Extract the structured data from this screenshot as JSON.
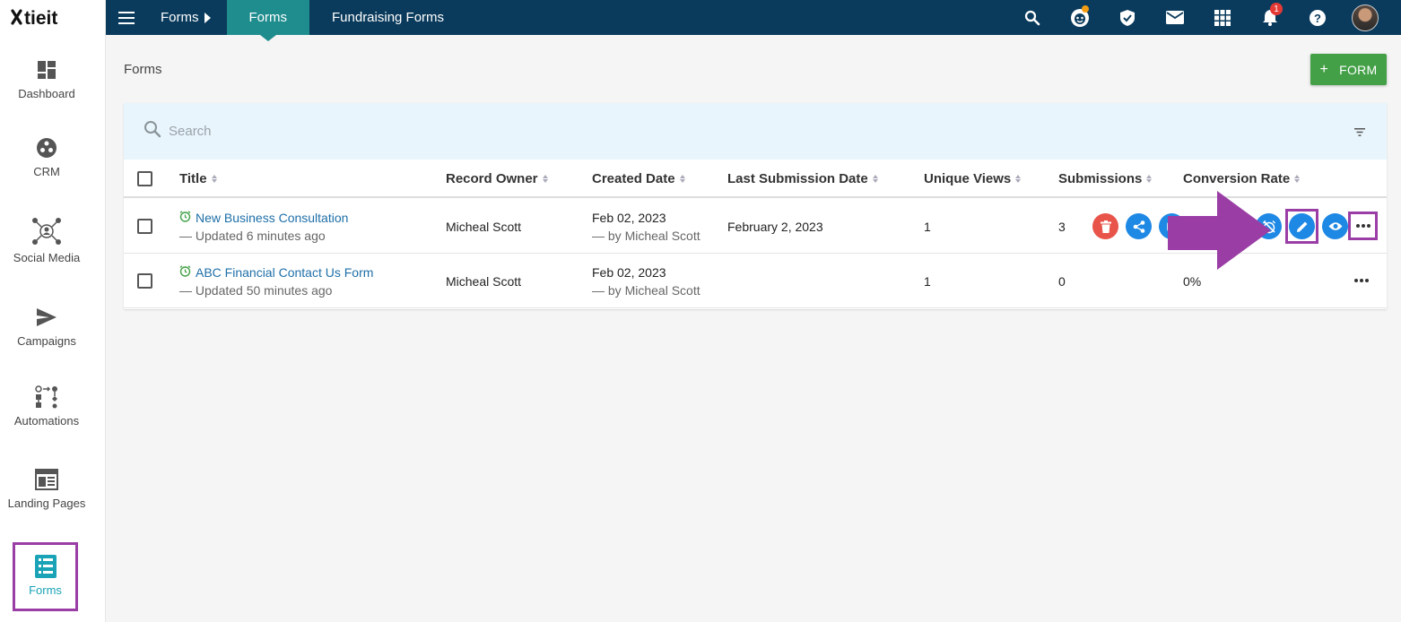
{
  "brand": {
    "logo_text": "tieit"
  },
  "sidebar": {
    "items": [
      {
        "label": "Dashboard"
      },
      {
        "label": "CRM"
      },
      {
        "label": "Social Media"
      },
      {
        "label": "Campaigns"
      },
      {
        "label": "Automations"
      },
      {
        "label": "Landing Pages"
      },
      {
        "label": "Forms"
      }
    ],
    "active_index": 6
  },
  "topbar": {
    "breadcrumb": "Forms",
    "active_tab": "Forms",
    "tab_2": "Fundraising Forms",
    "notification_count": "1",
    "icons": [
      "search-icon",
      "support-face-icon",
      "shield-check-icon",
      "mail-icon",
      "apps-grid-icon",
      "bell-icon",
      "help-icon",
      "avatar"
    ]
  },
  "page": {
    "title": "Forms",
    "add_button_plus": "+",
    "add_button_label": "FORM"
  },
  "search": {
    "placeholder": "Search"
  },
  "table": {
    "columns": [
      "Title",
      "Record Owner",
      "Created Date",
      "Last Submission Date",
      "Unique Views",
      "Submissions",
      "Conversion Rate"
    ],
    "rows": [
      {
        "title": "New Business Consultation",
        "updated": "— Updated 6 minutes ago",
        "owner": "Micheal Scott",
        "created": "Feb 02, 2023",
        "created_by": "— by Micheal Scott",
        "last_submission": "February 2, 2023",
        "unique_views": "1",
        "submissions": "3",
        "conversion_rate": ""
      },
      {
        "title": "ABC Financial Contact Us Form",
        "updated": "— Updated 50 minutes ago",
        "owner": "Micheal Scott",
        "created": "Feb 02, 2023",
        "created_by": "— by Micheal Scott",
        "last_submission": "",
        "unique_views": "1",
        "submissions": "0",
        "conversion_rate": "0%"
      }
    ]
  },
  "colors": {
    "topbar": "#0a3b5c",
    "active_tab": "#1f8c8e",
    "add_button": "#43a047",
    "delete_button": "#e8544a",
    "action_button": "#1e88e5",
    "highlight": "#9a3ea6",
    "link": "#1e6fa8"
  }
}
